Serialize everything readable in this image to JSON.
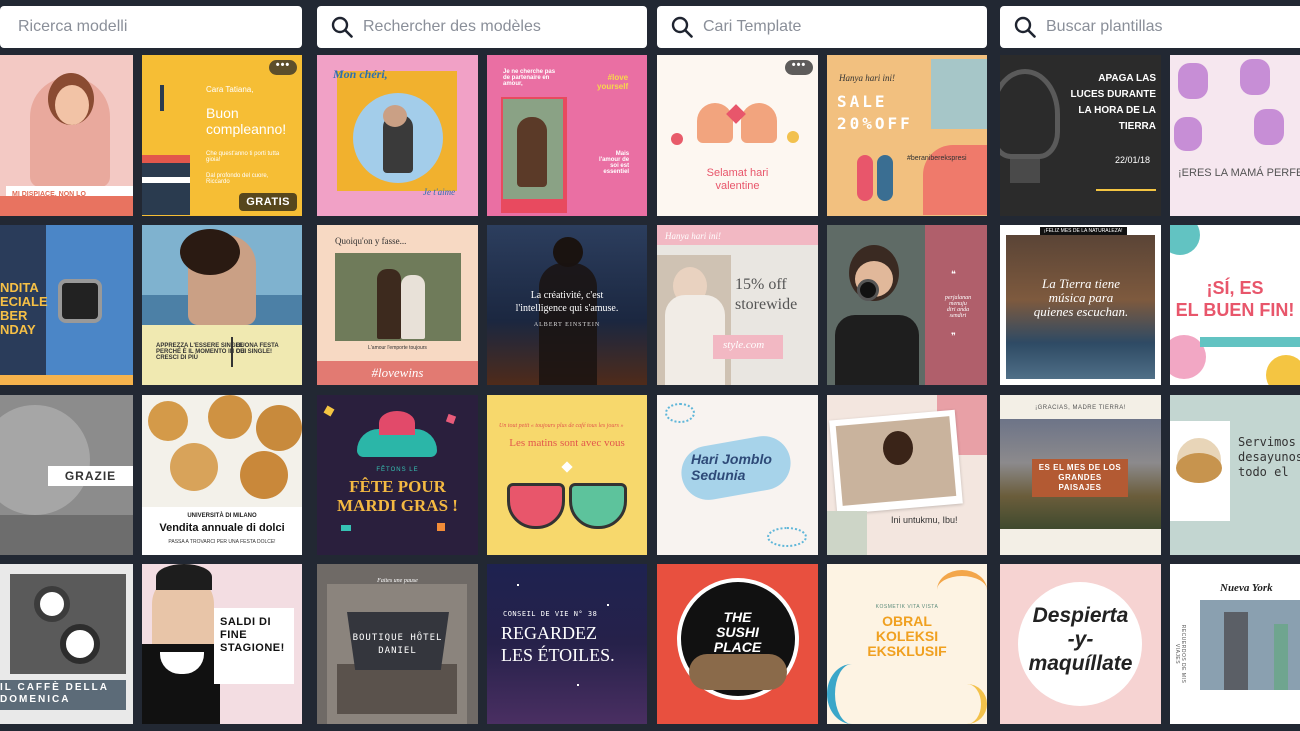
{
  "colors": {
    "background": "#222833",
    "search_bg": "#ffffff",
    "placeholder": "#8a8f99"
  },
  "columns": [
    {
      "search_placeholder": "Ricerca modelli",
      "templates": [
        {
          "lines": [
            "MI DISPIACE, NON LO CONDIVIDO!"
          ]
        },
        {
          "lines": [
            "Cara Tatiana,",
            "Buon\ncompleanno!",
            "Che quest'anno ti porti tutta gioia!",
            "Dal profondo del cuore, Riccardo"
          ],
          "badge": "GRATIS"
        },
        {
          "lines": [
            "NDITA\nECIALE\nBER\nNDAY"
          ]
        },
        {
          "lines": [
            "APPREZZA L'ESSERE SINGLE\nPERCHÉ È IL MOMENTO IN CUI\nCRESCI DI PIÙ",
            "BUONA FESTA\nDEI SINGLE!"
          ]
        },
        {
          "lines": [
            "GRAZIE"
          ]
        },
        {
          "lines": [
            "UNIVERSITÀ DI MILANO",
            "Vendita annuale di dolci",
            "PASSA A TROVARCI PER UNA FESTA DOLCE!"
          ]
        },
        {
          "lines": [
            "IL CAFFÈ DELLA\nDOMENICA"
          ]
        },
        {
          "lines": [
            "SALDI DI\nFINE\nSTAGIONE!"
          ]
        }
      ]
    },
    {
      "search_placeholder": "Rechercher des modèles",
      "templates": [
        {
          "lines": [
            "Mon chéri,",
            "Je t'aime"
          ]
        },
        {
          "lines": [
            "Je ne cherche pas\nde partenaire en\namour,",
            "#love\nyourself",
            "Mais\nl'amour de\nsoi est\nessentiel"
          ]
        },
        {
          "lines": [
            "Quoiqu'on y fasse...",
            "L'amour l'emporte toujours",
            "#lovewins"
          ]
        },
        {
          "lines": [
            "La créativité, c'est\nl'intelligence qui s'amuse.",
            "ALBERT EINSTEIN"
          ]
        },
        {
          "lines": [
            "FÊTONS LE",
            "FÊTE POUR\nMARDI GRAS !"
          ]
        },
        {
          "lines": [
            "Un tout petit « toujours plus de café tous les jours »",
            "Les matins sont avec vous"
          ]
        },
        {
          "lines": [
            "Faites une pause",
            "BOUTIQUE HÔTEL\nDANIEL"
          ]
        },
        {
          "lines": [
            "CONSEIL DE VIE N° 38",
            "REGARDEZ\nLES ÉTOILES."
          ]
        }
      ]
    },
    {
      "search_placeholder": "Cari Template",
      "templates": [
        {
          "lines": [
            "Selamat hari\nvalentine"
          ]
        },
        {
          "lines": [
            "Hanya hari ini!",
            "SALE\n20%OFF",
            "#beraniberekspresi"
          ]
        },
        {
          "lines": [
            "Hanya hari ini!",
            "15% off\nstorewide",
            "style.com"
          ]
        },
        {
          "lines": [
            "perjalanan\nmenuju\ndiri anda\nsendiri"
          ]
        },
        {
          "lines": [
            "Hari Jomblo\nSedunia"
          ]
        },
        {
          "lines": [
            "Ini untukmu, Ibu!"
          ]
        },
        {
          "lines": [
            "THE\nSUSHI\nPLACE"
          ]
        },
        {
          "lines": [
            "KOSMETIK VITA VISTA",
            "OBRAL\nKOLEKSI\nEKSKLUSIF"
          ]
        }
      ]
    },
    {
      "search_placeholder": "Buscar plantillas",
      "templates": [
        {
          "lines": [
            "APAGA LAS\nLUCES DURANTE\nLA HORA DE LA\nTIERRA",
            "22/01/18"
          ]
        },
        {
          "lines": [
            "¡ERES LA MAMÁ PERFECTA"
          ]
        },
        {
          "lines": [
            "¡FELIZ MES DE LA NATURALEZA!",
            "La Tierra tiene\nmúsica para\nquienes escuchan."
          ]
        },
        {
          "lines": [
            "¡SÍ, ES\nEL BUEN FIN!"
          ]
        },
        {
          "lines": [
            "¡GRACIAS, MADRE TIERRA!",
            "ES EL MES DE LOS\nGRANDES\nPAISAJES"
          ]
        },
        {
          "lines": [
            "Servimos\ndesayunos\ntodo el"
          ]
        },
        {
          "lines": [
            "Despierta\n-y-\nmaquíllate"
          ]
        },
        {
          "lines": [
            "Nueva York",
            "RECUERDOS DE MIS VIAJES"
          ]
        }
      ]
    }
  ]
}
